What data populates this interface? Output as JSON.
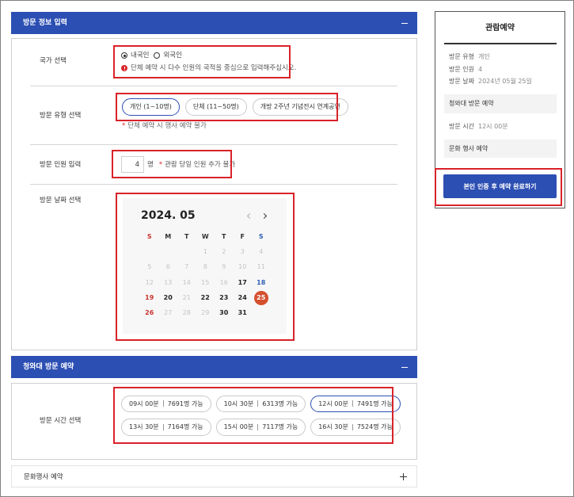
{
  "colors": {
    "primary": "#2c4fb3",
    "error": "#d9272e",
    "selected_date": "#d5502f",
    "sunday": "#c8342f",
    "saturday": "#2e5fb5",
    "highlight": "#d92229"
  },
  "visit_info": {
    "title": "방문 정보 입력",
    "toggle_icon": "minus-icon",
    "country": {
      "label": "국가 선택",
      "options": [
        {
          "label": "내국인",
          "selected": true
        },
        {
          "label": "외국인",
          "selected": false
        }
      ],
      "error_icon": "alert-circle-icon",
      "error": "단체 예약 시 다수 인원의 국적을 중심으로 입력해주십시오."
    },
    "visit_type": {
      "label": "방문 유형 선택",
      "options": [
        {
          "label": "개인 (1~10명)",
          "selected": true
        },
        {
          "label": "단체 (11~50명)",
          "selected": false
        },
        {
          "label": "개방 2주년 기념전시 연계공연",
          "selected": false
        }
      ],
      "note_mark": "*",
      "note": "단체 예약 시 행사 예약 불가"
    },
    "headcount": {
      "label": "방문 인원 입력",
      "value": "4",
      "unit": "명",
      "note_mark": "*",
      "note": "관람 당일 인원 추가 불가"
    },
    "date": {
      "label": "방문 날짜 선택",
      "calendar": {
        "title": "2024. 05",
        "prev_icon": "chevron-left-icon",
        "next_icon": "chevron-right-icon",
        "weekdays": [
          "S",
          "M",
          "T",
          "W",
          "T",
          "F",
          "S"
        ],
        "weeks": [
          [
            null,
            null,
            null,
            {
              "day": "1",
              "state": "disabled"
            },
            {
              "day": "2",
              "state": "disabled"
            },
            {
              "day": "3",
              "state": "disabled"
            },
            {
              "day": "4",
              "state": "disabled"
            }
          ],
          [
            {
              "day": "5",
              "state": "disabled"
            },
            {
              "day": "6",
              "state": "disabled"
            },
            {
              "day": "7",
              "state": "disabled"
            },
            {
              "day": "8",
              "state": "disabled"
            },
            {
              "day": "9",
              "state": "disabled"
            },
            {
              "day": "10",
              "state": "disabled"
            },
            {
              "day": "11",
              "state": "disabled"
            }
          ],
          [
            {
              "day": "12",
              "state": "disabled"
            },
            {
              "day": "13",
              "state": "disabled"
            },
            {
              "day": "14",
              "state": "disabled"
            },
            {
              "day": "15",
              "state": "disabled"
            },
            {
              "day": "16",
              "state": "disabled"
            },
            {
              "day": "17",
              "state": "available"
            },
            {
              "day": "18",
              "state": "sat"
            }
          ],
          [
            {
              "day": "19",
              "state": "sun"
            },
            {
              "day": "20",
              "state": "available"
            },
            {
              "day": "21",
              "state": "disabled"
            },
            {
              "day": "22",
              "state": "available"
            },
            {
              "day": "23",
              "state": "available"
            },
            {
              "day": "24",
              "state": "available"
            },
            {
              "day": "25",
              "state": "selected"
            }
          ],
          [
            {
              "day": "26",
              "state": "sun"
            },
            {
              "day": "27",
              "state": "disabled"
            },
            {
              "day": "28",
              "state": "disabled"
            },
            {
              "day": "29",
              "state": "disabled"
            },
            {
              "day": "30",
              "state": "available"
            },
            {
              "day": "31",
              "state": "available"
            },
            null
          ]
        ]
      }
    }
  },
  "palace_visit": {
    "title": "청와대 방문 예약",
    "toggle_icon": "minus-icon",
    "time_label": "방문 시간 선택",
    "slots": [
      {
        "time": "09시 00분",
        "capacity": "7691명 가능",
        "selected": false
      },
      {
        "time": "10시 30분",
        "capacity": "6313명 가능",
        "selected": false
      },
      {
        "time": "12시 00분",
        "capacity": "7491명 가능",
        "selected": true
      },
      {
        "time": "13시 30분",
        "capacity": "7164명 가능",
        "selected": false
      },
      {
        "time": "15시 00분",
        "capacity": "7117명 가능",
        "selected": false
      },
      {
        "time": "16시 30분",
        "capacity": "7524명 가능",
        "selected": false
      }
    ]
  },
  "culture_event": {
    "title": "문화행사 예약",
    "toggle_icon": "plus-icon"
  },
  "summary": {
    "title": "관람예약",
    "visit_rows": [
      {
        "label": "방문 유형",
        "value": "개인"
      },
      {
        "label": "방문 인원",
        "value": "4"
      },
      {
        "label": "방문 날짜",
        "value": "2024년 05월 25일"
      }
    ],
    "palace_section": "청와대 방문 예약",
    "palace_rows": [
      {
        "label": "방문 시간",
        "value": "12시 00분"
      }
    ],
    "culture_section": "문화 행사 예약",
    "submit_label": "본인 인증 후 예약 완료하기"
  }
}
